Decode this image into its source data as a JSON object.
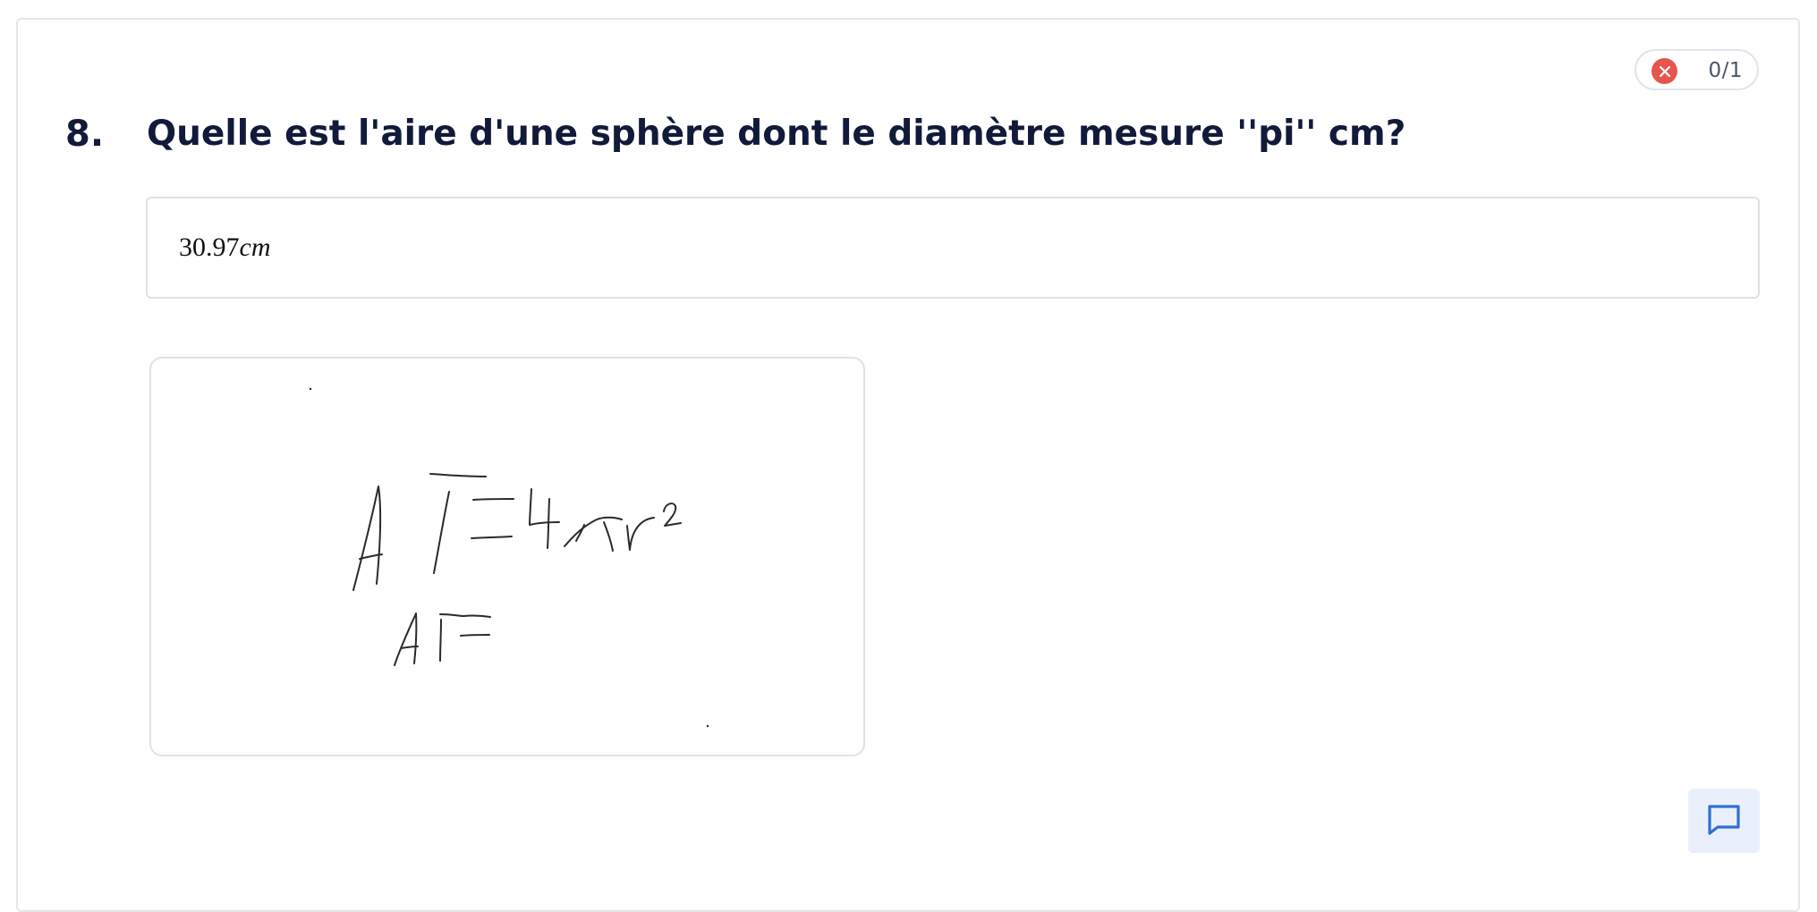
{
  "score": {
    "status_icon": "close-icon",
    "status_color": "#e5564f",
    "text": "0/1"
  },
  "question": {
    "number": "8.",
    "text": "Quelle est l'aire d'une sphère dont le diamètre mesure ''pi'' cm?"
  },
  "answer": {
    "value": "30.97",
    "unit": "cm"
  },
  "drawing": {
    "handwritten_lines": [
      "AT=4πr²",
      "AT="
    ]
  },
  "comment_button": {
    "icon": "comment-icon",
    "accent": "#2f6fd6"
  }
}
